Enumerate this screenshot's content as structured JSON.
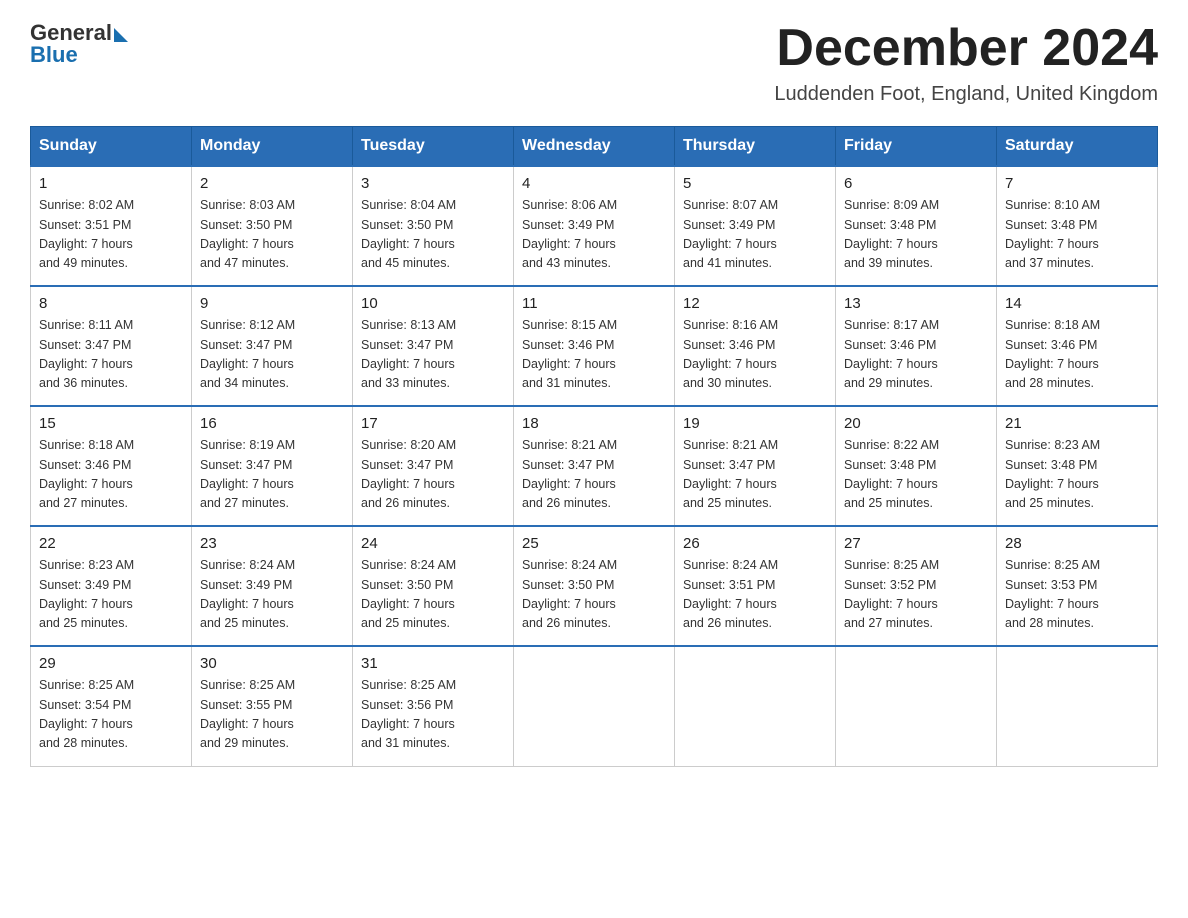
{
  "logo": {
    "general": "General",
    "blue": "Blue"
  },
  "header": {
    "month": "December 2024",
    "location": "Luddenden Foot, England, United Kingdom"
  },
  "days_of_week": [
    "Sunday",
    "Monday",
    "Tuesday",
    "Wednesday",
    "Thursday",
    "Friday",
    "Saturday"
  ],
  "weeks": [
    [
      {
        "day": "1",
        "sunrise": "8:02 AM",
        "sunset": "3:51 PM",
        "daylight": "7 hours and 49 minutes."
      },
      {
        "day": "2",
        "sunrise": "8:03 AM",
        "sunset": "3:50 PM",
        "daylight": "7 hours and 47 minutes."
      },
      {
        "day": "3",
        "sunrise": "8:04 AM",
        "sunset": "3:50 PM",
        "daylight": "7 hours and 45 minutes."
      },
      {
        "day": "4",
        "sunrise": "8:06 AM",
        "sunset": "3:49 PM",
        "daylight": "7 hours and 43 minutes."
      },
      {
        "day": "5",
        "sunrise": "8:07 AM",
        "sunset": "3:49 PM",
        "daylight": "7 hours and 41 minutes."
      },
      {
        "day": "6",
        "sunrise": "8:09 AM",
        "sunset": "3:48 PM",
        "daylight": "7 hours and 39 minutes."
      },
      {
        "day": "7",
        "sunrise": "8:10 AM",
        "sunset": "3:48 PM",
        "daylight": "7 hours and 37 minutes."
      }
    ],
    [
      {
        "day": "8",
        "sunrise": "8:11 AM",
        "sunset": "3:47 PM",
        "daylight": "7 hours and 36 minutes."
      },
      {
        "day": "9",
        "sunrise": "8:12 AM",
        "sunset": "3:47 PM",
        "daylight": "7 hours and 34 minutes."
      },
      {
        "day": "10",
        "sunrise": "8:13 AM",
        "sunset": "3:47 PM",
        "daylight": "7 hours and 33 minutes."
      },
      {
        "day": "11",
        "sunrise": "8:15 AM",
        "sunset": "3:46 PM",
        "daylight": "7 hours and 31 minutes."
      },
      {
        "day": "12",
        "sunrise": "8:16 AM",
        "sunset": "3:46 PM",
        "daylight": "7 hours and 30 minutes."
      },
      {
        "day": "13",
        "sunrise": "8:17 AM",
        "sunset": "3:46 PM",
        "daylight": "7 hours and 29 minutes."
      },
      {
        "day": "14",
        "sunrise": "8:18 AM",
        "sunset": "3:46 PM",
        "daylight": "7 hours and 28 minutes."
      }
    ],
    [
      {
        "day": "15",
        "sunrise": "8:18 AM",
        "sunset": "3:46 PM",
        "daylight": "7 hours and 27 minutes."
      },
      {
        "day": "16",
        "sunrise": "8:19 AM",
        "sunset": "3:47 PM",
        "daylight": "7 hours and 27 minutes."
      },
      {
        "day": "17",
        "sunrise": "8:20 AM",
        "sunset": "3:47 PM",
        "daylight": "7 hours and 26 minutes."
      },
      {
        "day": "18",
        "sunrise": "8:21 AM",
        "sunset": "3:47 PM",
        "daylight": "7 hours and 26 minutes."
      },
      {
        "day": "19",
        "sunrise": "8:21 AM",
        "sunset": "3:47 PM",
        "daylight": "7 hours and 25 minutes."
      },
      {
        "day": "20",
        "sunrise": "8:22 AM",
        "sunset": "3:48 PM",
        "daylight": "7 hours and 25 minutes."
      },
      {
        "day": "21",
        "sunrise": "8:23 AM",
        "sunset": "3:48 PM",
        "daylight": "7 hours and 25 minutes."
      }
    ],
    [
      {
        "day": "22",
        "sunrise": "8:23 AM",
        "sunset": "3:49 PM",
        "daylight": "7 hours and 25 minutes."
      },
      {
        "day": "23",
        "sunrise": "8:24 AM",
        "sunset": "3:49 PM",
        "daylight": "7 hours and 25 minutes."
      },
      {
        "day": "24",
        "sunrise": "8:24 AM",
        "sunset": "3:50 PM",
        "daylight": "7 hours and 25 minutes."
      },
      {
        "day": "25",
        "sunrise": "8:24 AM",
        "sunset": "3:50 PM",
        "daylight": "7 hours and 26 minutes."
      },
      {
        "day": "26",
        "sunrise": "8:24 AM",
        "sunset": "3:51 PM",
        "daylight": "7 hours and 26 minutes."
      },
      {
        "day": "27",
        "sunrise": "8:25 AM",
        "sunset": "3:52 PM",
        "daylight": "7 hours and 27 minutes."
      },
      {
        "day": "28",
        "sunrise": "8:25 AM",
        "sunset": "3:53 PM",
        "daylight": "7 hours and 28 minutes."
      }
    ],
    [
      {
        "day": "29",
        "sunrise": "8:25 AM",
        "sunset": "3:54 PM",
        "daylight": "7 hours and 28 minutes."
      },
      {
        "day": "30",
        "sunrise": "8:25 AM",
        "sunset": "3:55 PM",
        "daylight": "7 hours and 29 minutes."
      },
      {
        "day": "31",
        "sunrise": "8:25 AM",
        "sunset": "3:56 PM",
        "daylight": "7 hours and 31 minutes."
      },
      null,
      null,
      null,
      null
    ]
  ],
  "labels": {
    "sunrise_prefix": "Sunrise: ",
    "sunset_prefix": "Sunset: ",
    "daylight_prefix": "Daylight: "
  }
}
